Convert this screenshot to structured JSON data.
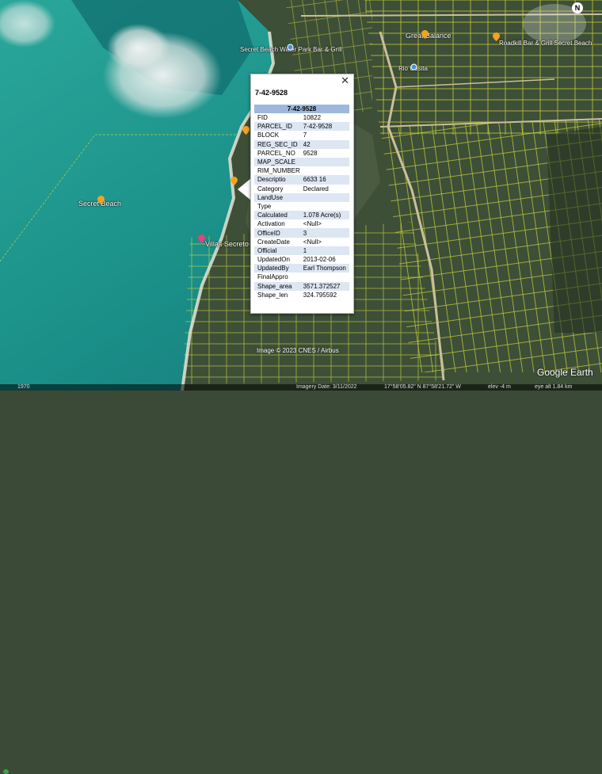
{
  "popup": {
    "title": "7-42-9528",
    "header": "7-42-9528",
    "close_glyph": "✕",
    "rows": [
      {
        "key": "FID",
        "value": "10822"
      },
      {
        "key": "PARCEL_ID",
        "value": "7-42-9528"
      },
      {
        "key": "BLOCK",
        "value": "7"
      },
      {
        "key": "REG_SEC_ID",
        "value": "42"
      },
      {
        "key": "PARCEL_NO",
        "value": "9528"
      },
      {
        "key": "MAP_SCALE",
        "value": ""
      },
      {
        "key": "RIM_NUMBER",
        "value": ""
      },
      {
        "key": "Descriptio",
        "value": "6633 16"
      },
      {
        "key": "Category",
        "value": "Declared"
      },
      {
        "key": "LandUse",
        "value": ""
      },
      {
        "key": "Type",
        "value": ""
      },
      {
        "key": "Calculated",
        "value": "1.078 Acre(s)"
      },
      {
        "key": "Activation",
        "value": "<Null>"
      },
      {
        "key": "OfficeID",
        "value": "3"
      },
      {
        "key": "CreateDate",
        "value": "<Null>"
      },
      {
        "key": "Official",
        "value": "1"
      },
      {
        "key": "UpdatedOn",
        "value": "2013-02-06"
      },
      {
        "key": "UpdatedBy",
        "value": "Earl Thompson"
      },
      {
        "key": "FinalAppro",
        "value": ""
      },
      {
        "key": "Shape_area",
        "value": "3571.372527"
      },
      {
        "key": "Shape_len",
        "value": "324.795592"
      }
    ]
  },
  "places": {
    "secret_beach": "Secret Beach",
    "secret_beach_water_park": "Secret Beach Water Park Bar & Grill",
    "great_balance": "Great Balance",
    "roadkill": "Roadkill Bar & Grill Secret Beach",
    "rio_casita": "Rio Casita",
    "villas_secreto": "Villas Secreto"
  },
  "map_text": {
    "attribution": "Image © 2023 CNES / Airbus",
    "logo": "Google Earth",
    "compass": "N"
  },
  "status_bar": {
    "year": "1970",
    "imagery_date": "Imagery Date: 3/11/2022",
    "coordinates": "17°58'05.82\" N   87°58'21.72\" W",
    "elevation": "elev   -4 m",
    "eye_alt": "eye alt   1.84 km"
  },
  "colors": {
    "parcel_line": "#e8f04a",
    "sea": "#1f9a92",
    "land": "#3d4f37",
    "popup_header": "#9db8dd",
    "popup_stripe": "#dde6f3"
  }
}
